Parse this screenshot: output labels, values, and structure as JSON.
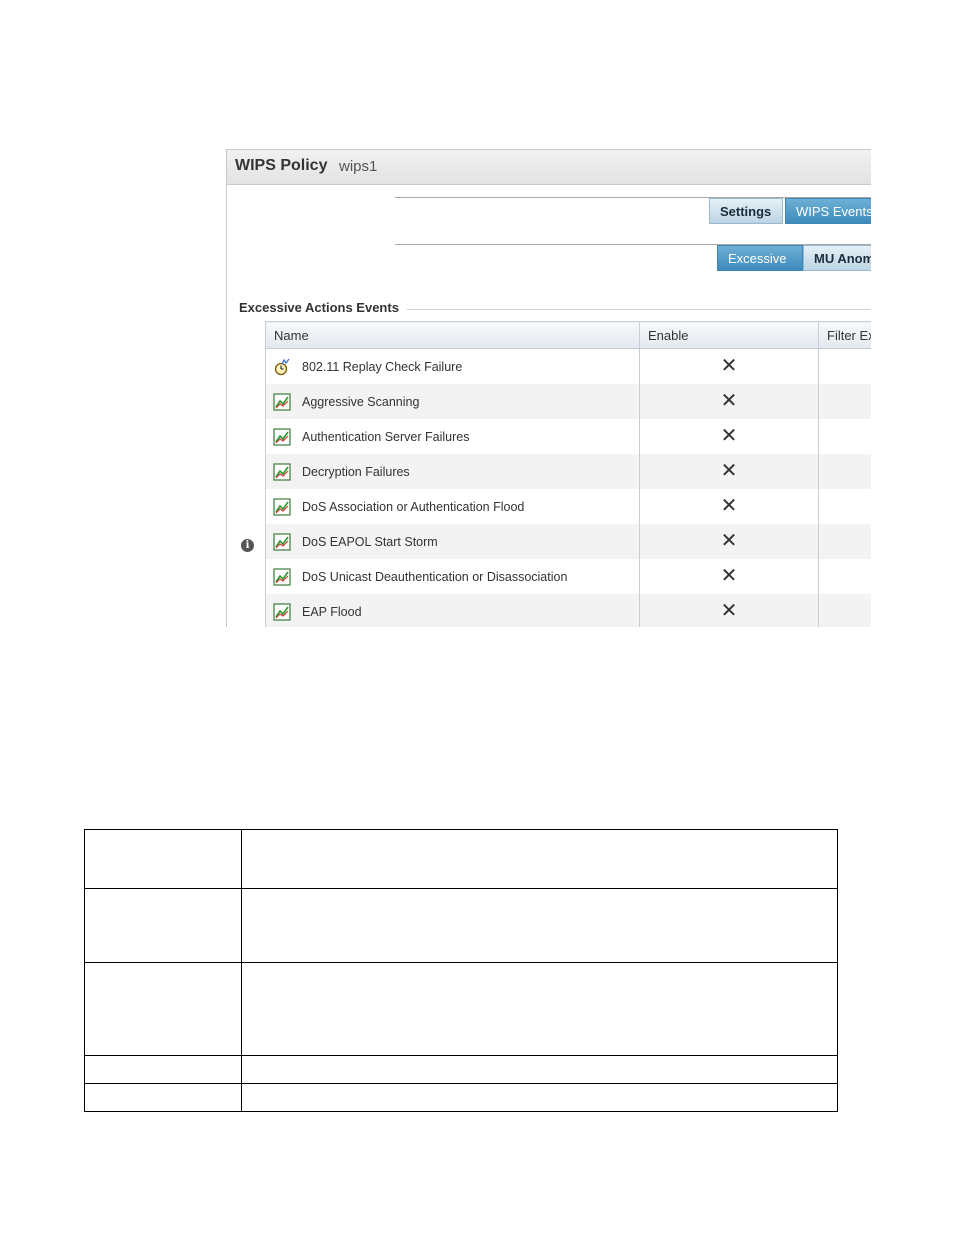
{
  "window": {
    "title": "WIPS Policy",
    "subtitle": "wips1"
  },
  "tabs_top": [
    {
      "label": "Settings"
    },
    {
      "label": "WIPS Events"
    }
  ],
  "tabs_sub": [
    {
      "label": "Excessive"
    },
    {
      "label": "MU Anom"
    }
  ],
  "section": {
    "title": "Excessive Actions Events"
  },
  "grid": {
    "columns": [
      "Name",
      "Enable",
      "Filter Ex"
    ],
    "rows": [
      {
        "name": "802.11 Replay Check Failure",
        "icon": "replay-timer-icon",
        "enable": "✕"
      },
      {
        "name": "Aggressive Scanning",
        "icon": "chart-icon",
        "enable": "✕"
      },
      {
        "name": "Authentication Server Failures",
        "icon": "chart-icon",
        "enable": "✕"
      },
      {
        "name": "Decryption Failures",
        "icon": "chart-icon",
        "enable": "✕"
      },
      {
        "name": "DoS Association or Authentication Flood",
        "icon": "chart-icon",
        "enable": "✕"
      },
      {
        "name": "DoS EAPOL Start Storm",
        "icon": "chart-icon",
        "enable": "✕"
      },
      {
        "name": "DoS Unicast Deauthentication or Disassociation",
        "icon": "chart-icon",
        "enable": "✕"
      },
      {
        "name": "EAP Flood",
        "icon": "chart-icon",
        "enable": "✕"
      }
    ]
  },
  "colors": {
    "disabled_x": "#e02020",
    "active_tab": "#3d8bbd",
    "inactive_tab": "#bcd4e4"
  }
}
